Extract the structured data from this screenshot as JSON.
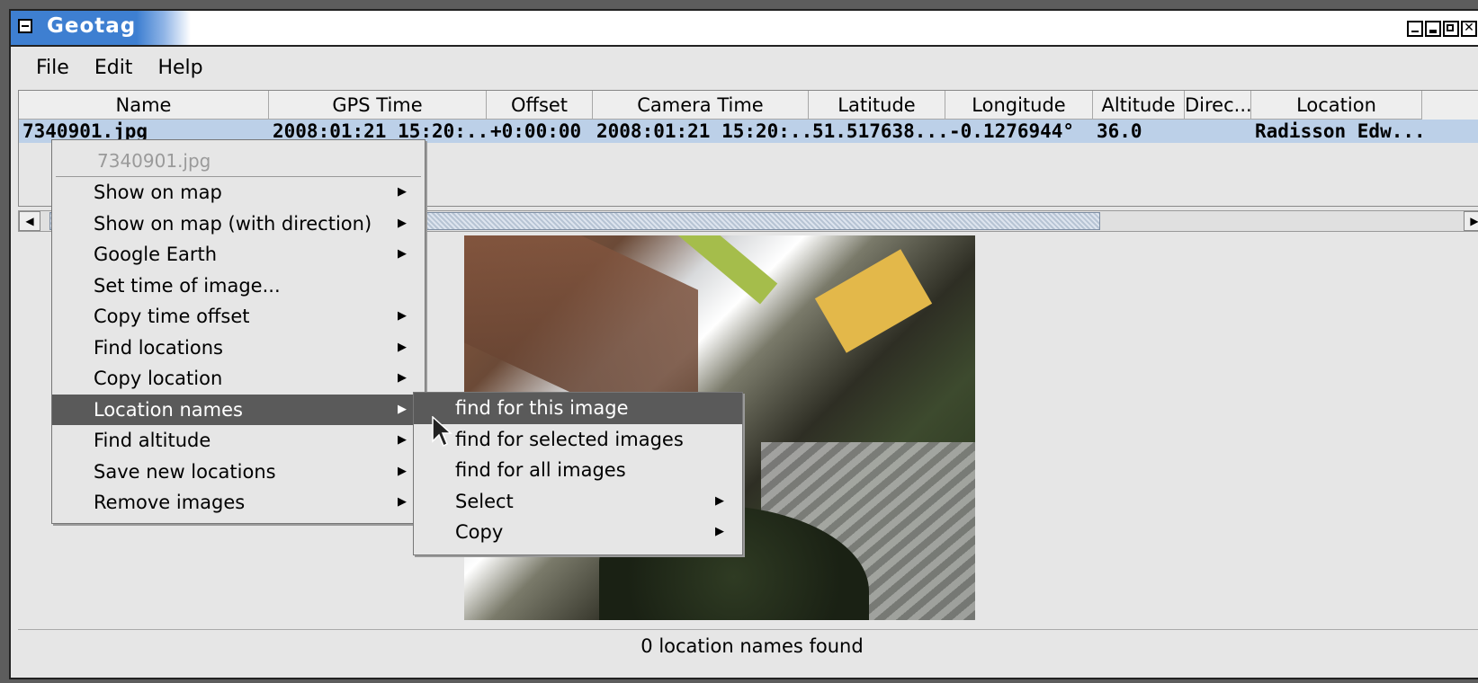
{
  "window": {
    "title": "Geotag"
  },
  "menubar": [
    "File",
    "Edit",
    "Help"
  ],
  "table": {
    "columns": [
      "Name",
      "GPS Time",
      "Offset",
      "Camera Time",
      "Latitude",
      "Longitude",
      "Altitude",
      "Direc...",
      "Location"
    ],
    "rows": [
      [
        "7340901.jpg",
        "2008:01:21 15:20:...",
        "+0:00:00",
        "2008:01:21 15:20:...",
        "51.517638...",
        "-0.1276944°",
        "36.0",
        "",
        "Radisson Edw..."
      ]
    ]
  },
  "context_menu": {
    "header": "7340901.jpg",
    "items": [
      {
        "label": "Show on map",
        "submenu": true
      },
      {
        "label": "Show on map (with direction)",
        "submenu": true
      },
      {
        "label": "Google Earth",
        "submenu": true
      },
      {
        "label": "Set time of image...",
        "submenu": false
      },
      {
        "label": "Copy time offset",
        "submenu": true
      },
      {
        "label": "Find locations",
        "submenu": true
      },
      {
        "label": "Copy location",
        "submenu": true
      },
      {
        "label": "Location names",
        "submenu": true,
        "active": true
      },
      {
        "label": "Find altitude",
        "submenu": true
      },
      {
        "label": "Save new locations",
        "submenu": true
      },
      {
        "label": "Remove images",
        "submenu": true
      }
    ]
  },
  "submenu": {
    "items": [
      {
        "label": "find for this image",
        "submenu": false,
        "active": true
      },
      {
        "label": "find for selected images",
        "submenu": false
      },
      {
        "label": "find for all images",
        "submenu": false
      },
      {
        "label": "Select",
        "submenu": true
      },
      {
        "label": "Copy",
        "submenu": true
      }
    ]
  },
  "statusbar": {
    "text": "0 location names found"
  },
  "colors": {
    "title_bar": "#3e7fd1",
    "selected_row": "#bcd0e8",
    "menu_highlight": "#5a5a5a"
  }
}
